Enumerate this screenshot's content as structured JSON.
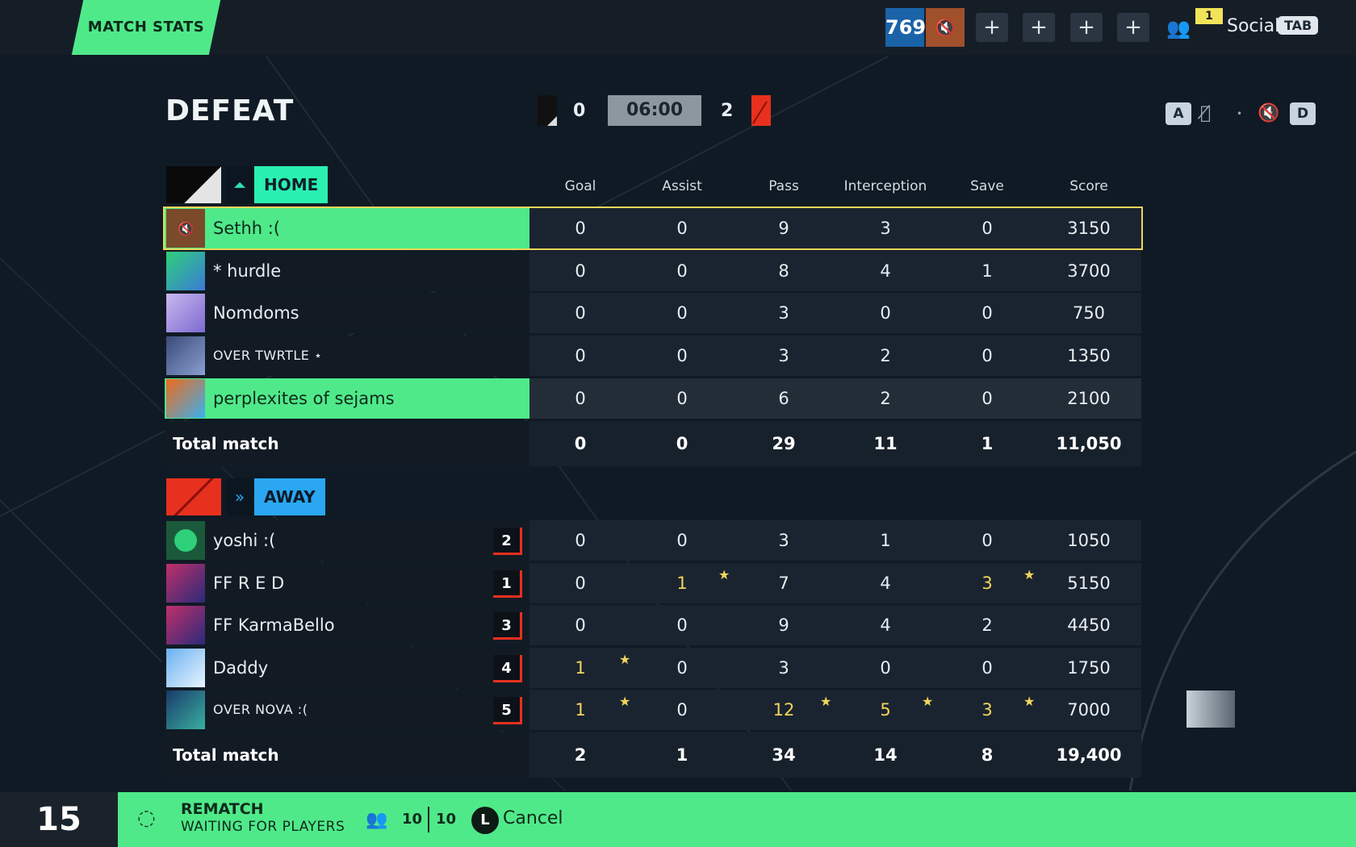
{
  "topbar": {
    "tab_label": "MATCH STATS",
    "level": "769",
    "notification_count": "1",
    "social_label": "Social",
    "social_key": "TAB",
    "plus_buttons": [
      "+",
      "+",
      "+",
      "+"
    ]
  },
  "match": {
    "result": "DEFEAT",
    "home_score": "0",
    "away_score": "2",
    "timer": "06:00",
    "key_left": "A",
    "key_right": "D"
  },
  "columns": [
    "Goal",
    "Assist",
    "Pass",
    "Interception",
    "Save",
    "Score"
  ],
  "home": {
    "team_name": "HOME",
    "color": "#4fe98a",
    "players": [
      {
        "name": "Sethh :(",
        "stats": [
          "0",
          "0",
          "9",
          "3",
          "0",
          "3150"
        ],
        "highlight": true
      },
      {
        "name": "* hurdle",
        "stats": [
          "0",
          "0",
          "8",
          "4",
          "1",
          "3700"
        ],
        "highlight": false
      },
      {
        "name": "Nomdoms",
        "stats": [
          "0",
          "0",
          "3",
          "0",
          "0",
          "750"
        ],
        "highlight": false
      },
      {
        "name": "OVER TWRTLE ⋆",
        "stats": [
          "0",
          "0",
          "3",
          "2",
          "0",
          "1350"
        ],
        "highlight": false
      },
      {
        "name": "perplexites of sejams",
        "stats": [
          "0",
          "0",
          "6",
          "2",
          "0",
          "2100"
        ],
        "highlight": true
      }
    ],
    "total_label": "Total match",
    "totals": [
      "0",
      "0",
      "29",
      "11",
      "1",
      "11,050"
    ]
  },
  "away": {
    "team_name": "AWAY",
    "color": "#2aa7f0",
    "players": [
      {
        "name": "yoshi :(",
        "rank": "2",
        "stats": [
          "0",
          "0",
          "3",
          "1",
          "0",
          "1050"
        ]
      },
      {
        "name": "FF R E D",
        "rank": "1",
        "stats": [
          "0",
          "1",
          "7",
          "4",
          "3",
          "5150"
        ]
      },
      {
        "name": "FF KarmaBello",
        "rank": "3",
        "stats": [
          "0",
          "0",
          "9",
          "4",
          "2",
          "4450"
        ]
      },
      {
        "name": "Daddy",
        "rank": "4",
        "stats": [
          "1",
          "0",
          "3",
          "0",
          "0",
          "1750"
        ]
      },
      {
        "name": "OVER NOVA :(",
        "rank": "5",
        "stats": [
          "1",
          "0",
          "12",
          "5",
          "3",
          "7000"
        ]
      }
    ],
    "total_label": "Total match",
    "totals": [
      "2",
      "1",
      "34",
      "14",
      "8",
      "19,400"
    ]
  },
  "footer": {
    "countdown": "15",
    "rematch_label": "REMATCH",
    "status": "WAITING FOR PLAYERS",
    "ready_count": "10",
    "total_count": "10",
    "cancel_key": "L",
    "cancel_label": "Cancel"
  }
}
